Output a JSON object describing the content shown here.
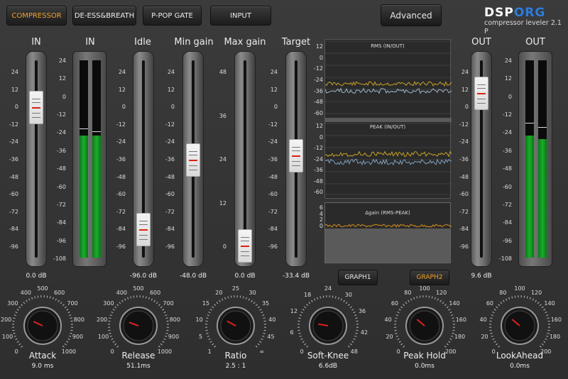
{
  "tabs": [
    {
      "label": "COMPRESSOR",
      "active": true
    },
    {
      "label": "DE-ESS&BREATH",
      "active": false
    },
    {
      "label": "P-POP GATE",
      "active": false
    },
    {
      "label": "INPUT",
      "active": false
    }
  ],
  "advanced_label": "Advanced",
  "logo": {
    "text_a": "DSP",
    "text_b": "ORG",
    "subtitle": "compressor leveler 2.1 P"
  },
  "sliders": {
    "in": {
      "title": "IN",
      "value": "0.0 dB"
    },
    "in_meter": {
      "title": "IN",
      "level_db": -27,
      "peak_db": -21
    },
    "idle": {
      "title": "Idle",
      "value": "-96.0 dB"
    },
    "min_gain": {
      "title": "Min gain",
      "value": "-48.0 dB"
    },
    "max_gain": {
      "title": "Max gain",
      "value": "0.0 dB"
    },
    "target": {
      "title": "Target",
      "value": "-33.4 dB"
    },
    "out": {
      "title": "OUT",
      "value": "9.6 dB"
    },
    "out_meter": {
      "title": "OUT",
      "level_db": -26,
      "peak_db": -14
    }
  },
  "scales": {
    "db24": [
      "24",
      "12",
      "0",
      "-12",
      "-24",
      "-36",
      "-48",
      "-60",
      "-72",
      "-84",
      "-96"
    ],
    "meter": [
      "24",
      "12",
      "0",
      "-12",
      "-24",
      "-36",
      "-48",
      "-60",
      "-72",
      "-84",
      "-96",
      "-108"
    ],
    "max_gain": [
      "48",
      "36",
      "24",
      "12",
      "0"
    ],
    "graph_rms": [
      "12",
      "0",
      "-12",
      "-24",
      "-36",
      "-48",
      "-60"
    ],
    "graph_peak": [
      "12",
      "0",
      "-12",
      "-24",
      "-36",
      "-48",
      "-60"
    ],
    "graph_delta": [
      "6",
      "4",
      "2",
      "0"
    ]
  },
  "graph": {
    "rms_title": "RMS (IN/OUT)",
    "peak_title": "PEAK (IN/OUT)",
    "delta_title": "Δgain (RMS-PEAK)",
    "colors": {
      "in": "#c9a227",
      "out": "#9fb6c9",
      "delta": "#d8901c"
    }
  },
  "graph_buttons": {
    "graph1": "GRAPH1",
    "graph2": "GRAPH2",
    "graph2_color": "#f0a32a"
  },
  "knobs": [
    {
      "name": "Attack",
      "value": "9.0 ms",
      "ticks": [
        "0",
        "100",
        "200",
        "300",
        "400",
        "500",
        "600",
        "700",
        "800",
        "900",
        "1000"
      ]
    },
    {
      "name": "Release",
      "value": "51.1ms",
      "ticks": [
        "0",
        "100",
        "200",
        "300",
        "400",
        "500",
        "600",
        "700",
        "800",
        "900",
        "1000"
      ]
    },
    {
      "name": "Ratio",
      "value": "2.5 : 1",
      "ticks": [
        "1",
        "5",
        "10",
        "15",
        "20",
        "25",
        "30",
        "35",
        "40",
        "45",
        "∞"
      ]
    },
    {
      "name": "Soft-Knee",
      "value": "6.6dB",
      "ticks": [
        "0",
        "6",
        "12",
        "18",
        "24",
        "30",
        "36",
        "42",
        "48"
      ]
    },
    {
      "name": "Peak Hold",
      "value": "0.0ms",
      "ticks": [
        "0",
        "20",
        "40",
        "60",
        "80",
        "100",
        "120",
        "140",
        "160",
        "180",
        "200"
      ]
    },
    {
      "name": "LookAhead",
      "value": "0.0ms",
      "ticks": [
        "0",
        "20",
        "40",
        "60",
        "80",
        "100",
        "120",
        "140",
        "160",
        "180",
        "200"
      ]
    }
  ]
}
